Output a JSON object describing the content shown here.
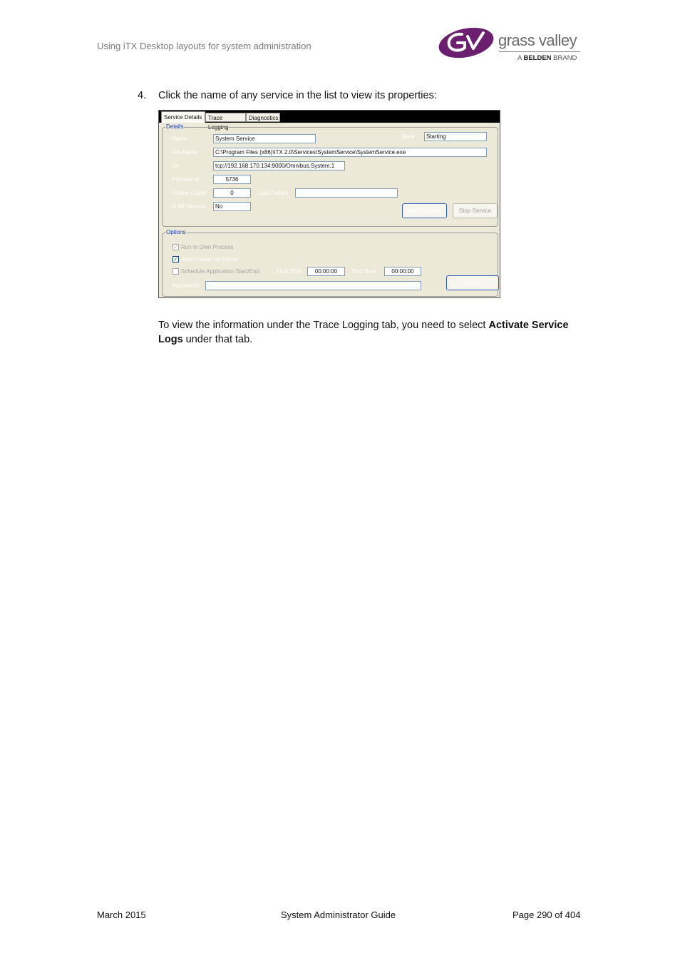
{
  "header": {
    "title": "Using iTX Desktop layouts for system administration",
    "logo": {
      "wordmark": "grass valley",
      "sub_prefix": "A ",
      "sub_brand": "BELDEN",
      "sub_suffix": " BRAND"
    }
  },
  "step": {
    "number": "4.",
    "text": "Click the name of any service in the list to view its properties:"
  },
  "screenshot": {
    "tabs": [
      "Service Details",
      "Trace Logging",
      "Diagnostics"
    ],
    "details": {
      "title": "Details",
      "name_label": "Name",
      "name_value": "System Service",
      "state_label": "State",
      "state_value": "Starting",
      "filename_label": "File Name",
      "filename_value": "C:\\Program Files (x86)\\iTX 2.0\\Services\\SystemService\\SystemService.exe",
      "uri_label": "Uri",
      "uri_value": "tcp://192.168.170.134:9000/Omnibus.System.1",
      "process_id_label": "Process Id",
      "process_id_value": "5736",
      "failure_count_label": "Failure Count",
      "failure_count_value": "0",
      "last_failure_label": "Last Failure",
      "last_failure_value": "",
      "nt_service_label": "Is NT Service",
      "nt_service_value": "No",
      "start_button": "Start Service",
      "stop_button": "Stop Service"
    },
    "options": {
      "title": "Options",
      "run_own_process": "Run In Own Process",
      "auto_restart": "Auto Restart on failure",
      "schedule": "Schedule Application Start/End",
      "start_time_label": "Start Time",
      "start_time_value": "00:00:00",
      "end_time_label": "End Time",
      "end_time_value": "00:00:00",
      "arguments_label": "Arguments",
      "arguments_value": "",
      "apply_button": "Apply"
    }
  },
  "paragraph": {
    "before": "To view the information under the Trace Logging tab, you need to select ",
    "bold": "Activate Service Logs",
    "after": " under that tab."
  },
  "footer": {
    "date": "March 2015",
    "guide": "System Administrator Guide",
    "page": "Page 290 of 404"
  },
  "colors": {
    "logo_purple": "#6b1f6e",
    "group_title_blue": "#1a3fa8"
  }
}
